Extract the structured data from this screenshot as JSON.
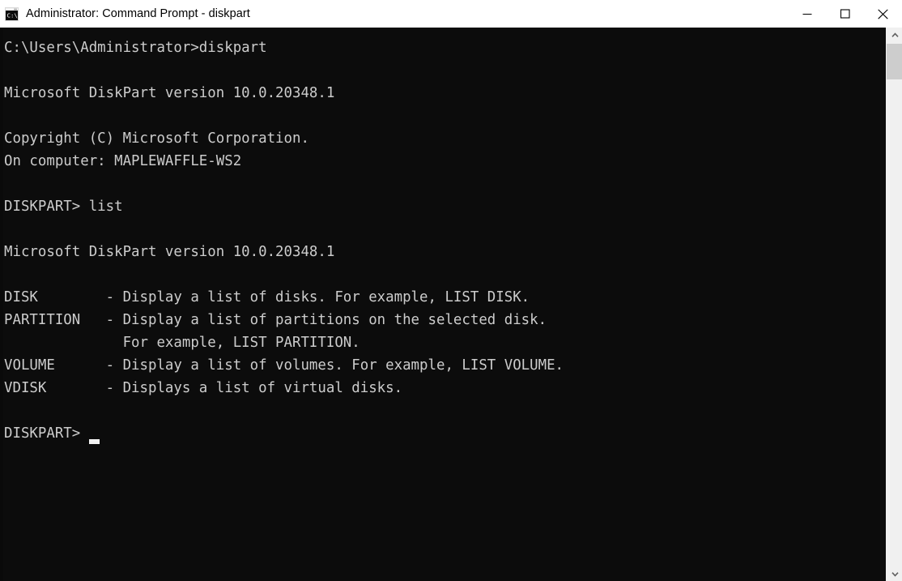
{
  "window": {
    "title": "Administrator: Command Prompt - diskpart",
    "icon": "command-prompt-icon",
    "background_color": "#0c0c0c",
    "titlebar_color": "#ffffff",
    "text_color": "#cccccc"
  },
  "titlebar_buttons": {
    "minimize": "minimize-icon",
    "maximize": "maximize-icon",
    "close": "close-icon"
  },
  "scrollbar": {
    "up_arrow": "chevron-up-icon",
    "down_arrow": "chevron-down-icon",
    "thumb": "scrollbar-thumb"
  },
  "terminal": {
    "lines": [
      "C:\\Users\\Administrator>diskpart",
      "",
      "Microsoft DiskPart version 10.0.20348.1",
      "",
      "Copyright (C) Microsoft Corporation.",
      "On computer: MAPLEWAFFLE-WS2",
      "",
      "DISKPART> list",
      "",
      "Microsoft DiskPart version 10.0.20348.1",
      "",
      "DISK        - Display a list of disks. For example, LIST DISK.",
      "PARTITION   - Display a list of partitions on the selected disk.",
      "              For example, LIST PARTITION.",
      "VOLUME      - Display a list of volumes. For example, LIST VOLUME.",
      "VDISK       - Displays a list of virtual disks.",
      "",
      "DISKPART>"
    ],
    "prompt": "DISKPART>",
    "command_entered": "list",
    "cwd_prompt": "C:\\Users\\Administrator>",
    "command_launched": "diskpart",
    "version": "10.0.20348.1",
    "copyright": "Copyright (C) Microsoft Corporation.",
    "computer_label": "On computer:",
    "computer_name": "MAPLEWAFFLE-WS2",
    "help_entries": [
      {
        "name": "DISK",
        "description": "Display a list of disks. For example, LIST DISK."
      },
      {
        "name": "PARTITION",
        "description": "Display a list of partitions on the selected disk. For example, LIST PARTITION."
      },
      {
        "name": "VOLUME",
        "description": "Display a list of volumes. For example, LIST VOLUME."
      },
      {
        "name": "VDISK",
        "description": "Displays a list of virtual disks."
      }
    ]
  }
}
